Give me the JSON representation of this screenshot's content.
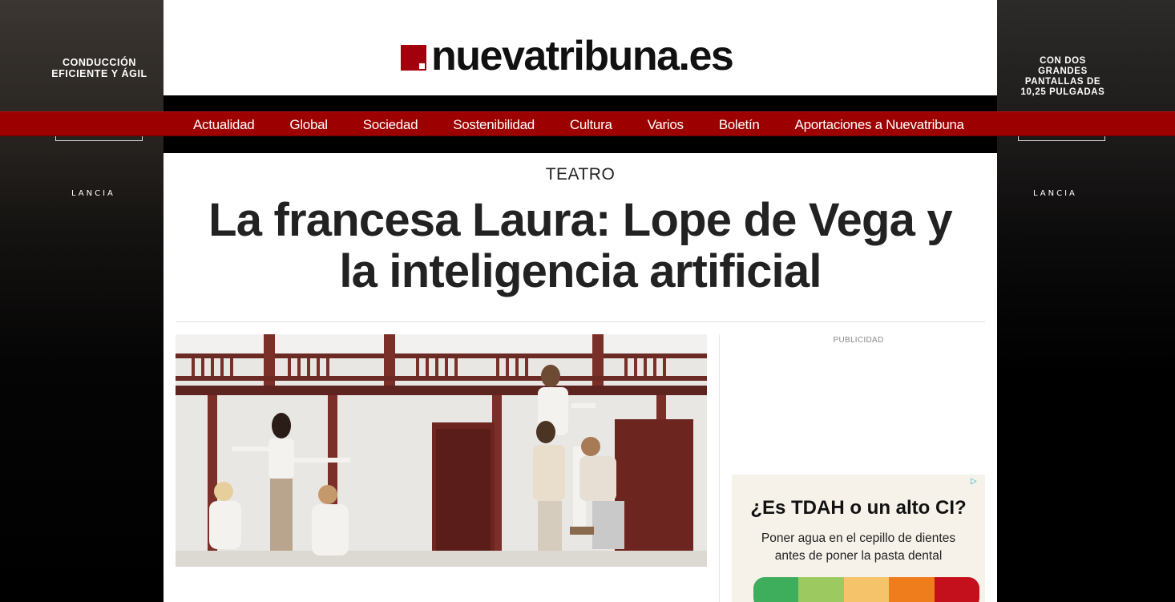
{
  "ads": {
    "left_skin": {
      "headline": "CONDUCCIÓN EFICIENTE Y ÁGIL",
      "brand": "LANCIA"
    },
    "right_skin": {
      "headline": "CON DOS GRANDES PANTALLAS DE 10,25 PULGADAS",
      "brand": "LANCIA"
    },
    "sidebar": {
      "label": "PUBLICIDAD",
      "title": "¿Es TDAH o un alto CI?",
      "body": "Poner agua en el cepillo de dientes antes de poner la pasta dental",
      "colors": [
        "#3fae5c",
        "#9cc960",
        "#f5c46a",
        "#f07d1b",
        "#c3101c"
      ]
    }
  },
  "header": {
    "logo_text": "nuevatribuna.es",
    "accent": "#a3000d"
  },
  "nav": {
    "items": [
      "Actualidad",
      "Global",
      "Sociedad",
      "Sostenibilidad",
      "Cultura",
      "Varios",
      "Boletín",
      "Aportaciones a Nuevatribuna"
    ],
    "background": "#9c0000"
  },
  "article": {
    "section": "TEATRO",
    "headline": "La francesa Laura: Lope de Vega y la inteligencia artificial"
  }
}
